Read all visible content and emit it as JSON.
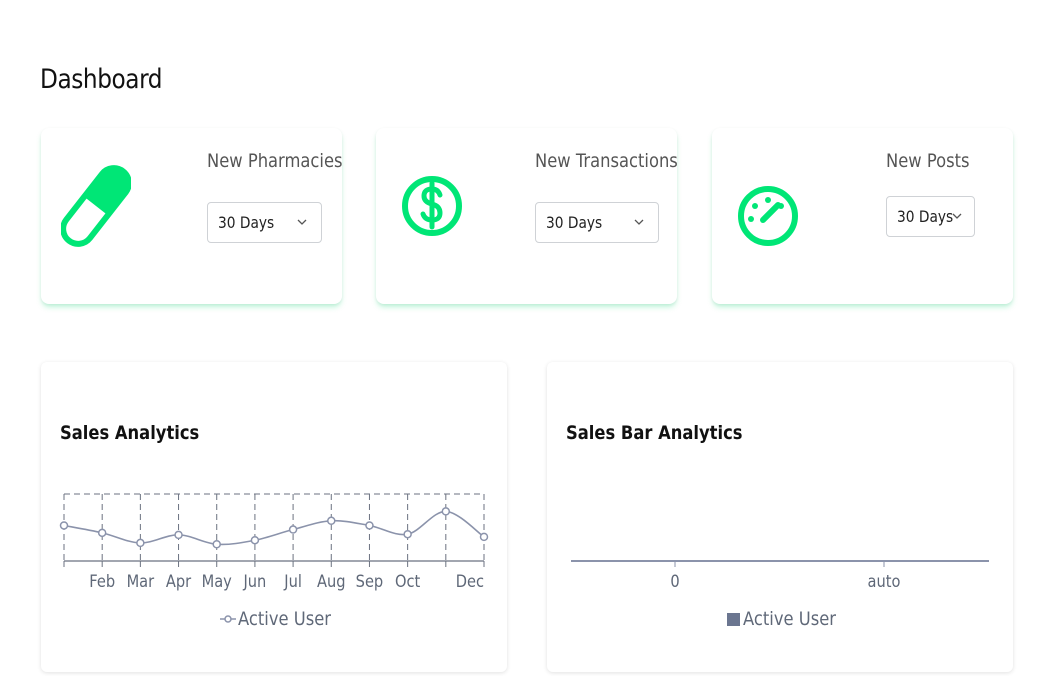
{
  "page": {
    "title": "Dashboard"
  },
  "cards": [
    {
      "label": "New Pharmacies",
      "period": "30 Days",
      "icon": "pill-icon"
    },
    {
      "label": "New Transactions",
      "period": "30 Days",
      "icon": "dollar-circle-icon"
    },
    {
      "label": "New Posts",
      "period": "30 Days",
      "icon": "speedometer-icon"
    }
  ],
  "colors": {
    "accent": "#00e676",
    "line": "#8b93ab",
    "grid": "#6b7280",
    "bar_legend": "#6b7690"
  },
  "sales": {
    "title": "Sales Analytics",
    "legend": "Active User"
  },
  "sales_bar": {
    "title": "Sales Bar Analytics",
    "legend": "Active User"
  },
  "chart_data": [
    {
      "type": "line",
      "title": "Sales Analytics",
      "x_tick_labels": [
        "Feb",
        "Mar",
        "Apr",
        "May",
        "Jun",
        "Jul",
        "Aug",
        "Sep",
        "Oct",
        "Dec"
      ],
      "grid": true,
      "legend_position": "bottom",
      "series": [
        {
          "name": "Active User",
          "values": [
            0.47,
            0.58,
            0.73,
            0.61,
            0.75,
            0.69,
            0.53,
            0.4,
            0.47,
            0.6,
            0.26,
            0.64
          ]
        }
      ]
    },
    {
      "type": "bar",
      "title": "Sales Bar Analytics",
      "x_tick_labels": [
        "0",
        "auto"
      ],
      "legend_position": "bottom",
      "series": [
        {
          "name": "Active User",
          "values": []
        }
      ]
    }
  ]
}
